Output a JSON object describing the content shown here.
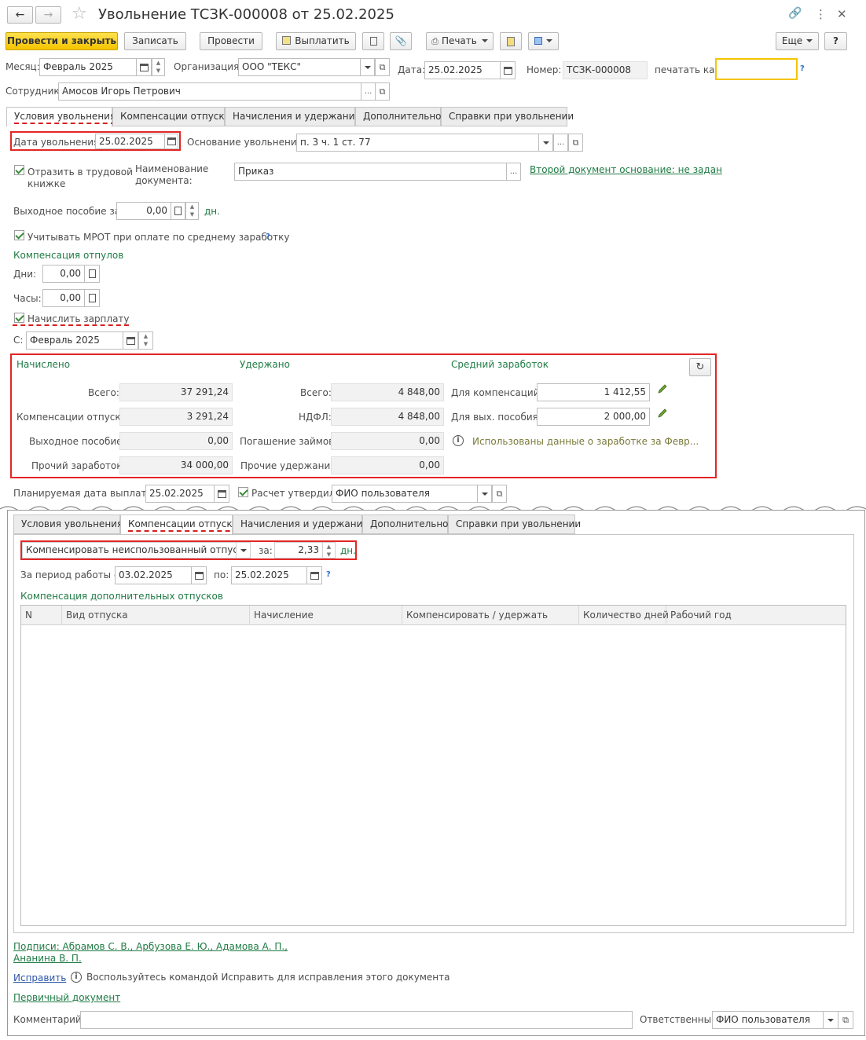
{
  "window": {
    "title": "Увольнение ТСЗК-000008 от 25.02.2025"
  },
  "toolbar": {
    "post_close": "Провести и закрыть",
    "write": "Записать",
    "post": "Провести",
    "pay": "Выплатить",
    "print": "Печать",
    "more": "Еще",
    "help": "?"
  },
  "header": {
    "month_label": "Месяц:",
    "month_value": "Февраль 2025",
    "org_label": "Организация:",
    "org_value": "ООО \"ТЕКС\"",
    "date_label": "Дата:",
    "date_value": "25.02.2025",
    "number_label": "Номер:",
    "number_value": "ТСЗК-000008",
    "print_as_label": "печатать как:",
    "print_as_value": "",
    "employee_label": "Сотрудник:",
    "employee_value": "Амосов Игорь Петрович",
    "help": "?"
  },
  "tabs": [
    "Условия увольнения",
    "Компенсации отпуска",
    "Начисления и удержания",
    "Дополнительно",
    "Справки при увольнении"
  ],
  "conditions": {
    "dismissal_date_label": "Дата увольнения:",
    "dismissal_date_value": "25.02.2025",
    "basis_label": "Основание увольнения:",
    "basis_value": "п. 3 ч. 1 ст. 77",
    "reflect_label_1": "Отразить в трудовой",
    "reflect_label_2": "книжке",
    "docname_label_1": "Наименование",
    "docname_label_2": "документа:",
    "docname_value": "Приказ",
    "second_doc_link": "Второй документ основание: не задан",
    "severance_label": "Выходное пособие за:",
    "severance_value": "0,00",
    "days_unit": "дн.",
    "mrot_label": "Учитывать МРОТ при оплате по среднему заработку",
    "comp_header": "Компенсация отпулов",
    "days_label": "Дни:",
    "days_value": "0,00",
    "hours_label": "Часы:",
    "hours_value": "0,00",
    "accrue_label": "Начислить зарплату",
    "from_label": "С:",
    "from_value": "Февраль 2025"
  },
  "summary": {
    "accrued_header": "Начислено",
    "withheld_header": "Удержано",
    "average_header": "Средний заработок",
    "total_label": "Всего:",
    "total_value": "37 291,24",
    "comp_label": "Компенсации отпуска:",
    "comp_value": "3 291,24",
    "sev_label": "Выходное пособие:",
    "sev_value": "0,00",
    "other_label": "Прочий заработок:",
    "other_value": "34 000,00",
    "w_total_label": "Всего:",
    "w_total_value": "4 848,00",
    "ndfl_label": "НДФЛ:",
    "ndfl_value": "4 848,00",
    "loans_label": "Погашение займов:",
    "loans_value": "0,00",
    "w_other_label": "Прочие удержания:",
    "w_other_value": "0,00",
    "avg_comp_label": "Для компенсаций:",
    "avg_comp_value": "1 412,55",
    "avg_sev_label": "Для вых. пособия:",
    "avg_sev_value": "2 000,00",
    "info_text": "Использованы данные о заработке за Февр..."
  },
  "payment": {
    "planned_label": "Планируемая дата выплаты:",
    "planned_value": "25.02.2025",
    "approved_label": "Расчет утвердил",
    "approved_value": "ФИО пользователя"
  },
  "compensation": {
    "mode_value": "Компенсировать неиспользованный отпуск",
    "for_label": "за:",
    "for_value": "2,33",
    "unit": "дн.",
    "period_label": "За период работы с:",
    "period_from": "03.02.2025",
    "to_label": "по:",
    "period_to": "25.02.2025",
    "additional_header": "Компенсация дополнительных отпусков",
    "columns": [
      "N",
      "Вид отпуска",
      "Начисление",
      "Компенсировать / удержать",
      "Количество дней",
      "Рабочий год"
    ],
    "help": "?"
  },
  "footer": {
    "signatures_1": "Подписи: Абрамов С. В., Арбузова Е. Ю., Адамова А. П.,",
    "signatures_2": "Ананина В. П.",
    "fix_link": "Исправить",
    "fix_hint": "Воспользуйтесь командой Исправить для исправления этого документа",
    "primary_link": "Первичный документ",
    "comment_label": "Комментарий:",
    "comment_value": "",
    "responsible_label": "Ответственный:",
    "responsible_value": "ФИО пользователя"
  },
  "colors": {
    "accent_yellow": "#f5c400",
    "highlight_red": "#e32626",
    "link_green": "#1f7b44"
  }
}
